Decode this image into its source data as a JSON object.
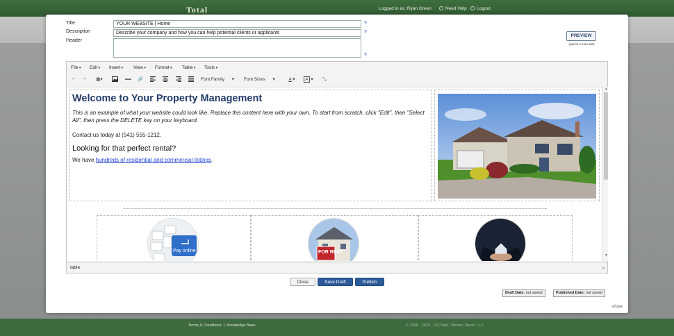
{
  "app": {
    "brand": "Total",
    "logged_in_label": "Logged in as:",
    "user_name": "Ryan Green",
    "need_help": "Need Help",
    "logout": "Logout"
  },
  "form": {
    "title_label": "Title",
    "title_value": "YOUR WEBSITE | Home",
    "description_label": "Description",
    "description_value": "Describe your company and how you can help potential clients or applicants",
    "header_label": "Header",
    "header_value": "",
    "help_mark": "?",
    "preview_label": "PREVIEW",
    "preview_note": "(opens in new tab)"
  },
  "editor": {
    "menus": [
      "File",
      "Edit",
      "Insert",
      "View",
      "Format",
      "Table",
      "Tools"
    ],
    "font_family": "Font Family",
    "font_sizes": "Font Sizes",
    "status_path": "table",
    "toolbar_icons": [
      "undo-icon",
      "redo-icon",
      "table-icon",
      "image-icon",
      "horizontal-rule-icon",
      "link-icon",
      "align-left-icon",
      "align-center-icon",
      "align-right-icon",
      "align-justify-icon",
      "text-color-icon",
      "background-color-icon",
      "fullscreen-icon"
    ]
  },
  "content": {
    "heading": "Welcome to Your Property Management",
    "intro": "This is an example of what your website could look like. Replace this content here with your own. To start from scratch, click \"Edit\", then \"Select All\", then press the DELETE key on your keyboard.",
    "contact": "Contact us today at (541) 555-1212.",
    "subheading": "Looking for that perfect rental?",
    "have_prefix": "We have ",
    "have_link": "hundreds of residential and commercial listings",
    "have_suffix": ".",
    "pay_online_key": "Pay online",
    "for_rent_sign": "FOR RENT"
  },
  "actions": {
    "close": "Close",
    "save_draft": "Save Draft",
    "publish": "Publish"
  },
  "dates": {
    "draft_label": "Draft Date:",
    "draft_value": "not saved",
    "published_label": "Published Date:",
    "published_value": "not saved"
  },
  "modal_close": "close",
  "footer": {
    "terms": "Terms & Conditions",
    "separator": "|",
    "kb": "Knowledge Base",
    "copyright": "© 2006 - 2019 · CICTotal / Rentec Direct, LLC"
  },
  "colors": {
    "header_green": "#3f6e3f",
    "button_blue": "#2d5b9a",
    "heading_navy": "#233c68",
    "link_blue": "#1a3fd3"
  }
}
